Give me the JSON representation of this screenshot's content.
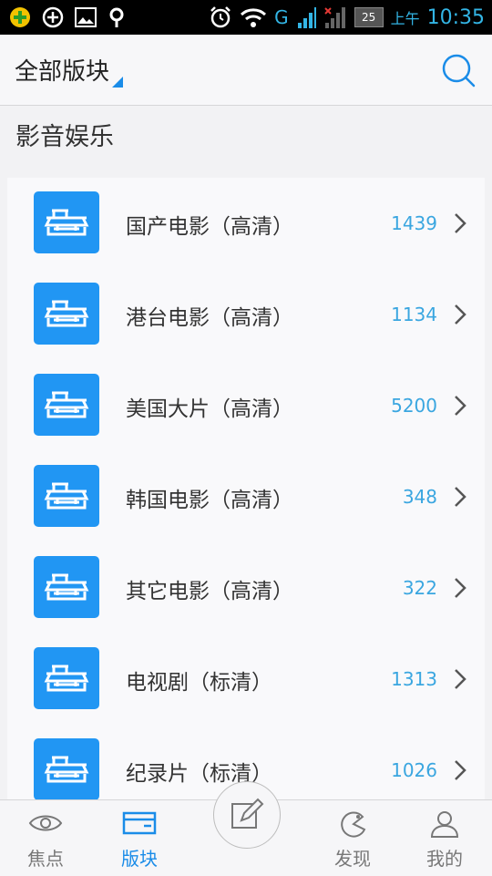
{
  "status": {
    "time": "10:35",
    "ampm": "上午",
    "battery": "25",
    "signal_label": "G"
  },
  "header": {
    "title": "全部版块"
  },
  "section": {
    "title": "影音娱乐"
  },
  "boards": [
    {
      "label": "国产电影（高清）",
      "count": "1439"
    },
    {
      "label": "港台电影（高清）",
      "count": "1134"
    },
    {
      "label": "美国大片（高清）",
      "count": "5200"
    },
    {
      "label": "韩国电影（高清）",
      "count": "348"
    },
    {
      "label": "其它电影（高清）",
      "count": "322"
    },
    {
      "label": "电视剧（标清）",
      "count": "1313"
    },
    {
      "label": "纪录片（标清）",
      "count": "1026"
    }
  ],
  "nav": {
    "focus": "焦点",
    "boards": "版块",
    "discover": "发现",
    "mine": "我的"
  },
  "colors": {
    "accent": "#1a8ce8",
    "icon_bg": "#2196f3",
    "count": "#3aa6e0"
  }
}
